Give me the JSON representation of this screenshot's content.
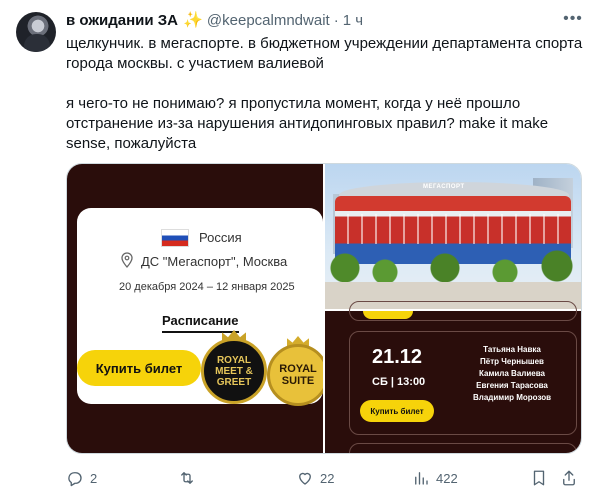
{
  "tweet": {
    "display_name": "в ожидании ЗА",
    "handle": "@keepcalmndwait",
    "separator": "·",
    "time": "1 ч",
    "text": "щелкунчик. в мегаспорте. в бюджетном учреждении департамента спорта города москвы. с участием валиевой\n\nя чего-то не понимаю? я пропустила момент, когда у неё прошло отстранение из-за нарушения антидопинговых правил? make it make sense, пожалуйста"
  },
  "media": {
    "left": {
      "country": "Россия",
      "venue": "ДС \"Мегаспорт\", Москва",
      "dates": "20 декабря 2024 – 12 января 2025",
      "schedule_label": "Расписание",
      "buy_label": "Купить билет",
      "badge_meet": "ROYAL MEET & GREET",
      "badge_suite": "ROYAL SUITE"
    },
    "photo": {
      "sign": "МЕГАСПОРТ"
    },
    "event": {
      "date": "21.12",
      "time": "СБ | 13:00",
      "buy_label": "Купить билет",
      "performers": [
        "Татьяна Навка",
        "Пётр Чернышев",
        "Камила Валиева",
        "Евгения Тарасова",
        "Владимир Морозов"
      ]
    }
  },
  "actions": {
    "replies": "2",
    "retweets": "",
    "likes": "22",
    "views": "422"
  },
  "colors": {
    "accent_yellow": "#f6d30a",
    "dark_bg": "#2a0d0b",
    "muted": "#536471"
  }
}
